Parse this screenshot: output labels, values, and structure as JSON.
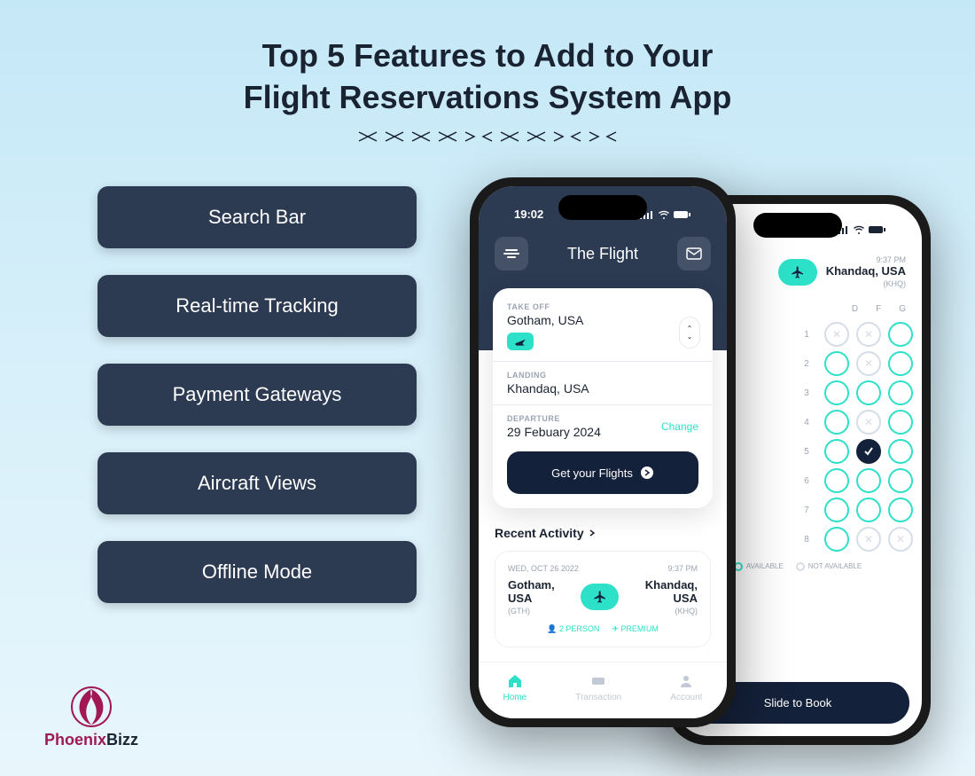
{
  "title_line1": "Top 5 Features to Add to Your",
  "title_line2": "Flight Reservations System App",
  "features": [
    "Search Bar",
    "Real-time Tracking",
    "Payment Gateways",
    "Aircraft Views",
    "Offline Mode"
  ],
  "logo": {
    "part1": "Phoenix",
    "part2": "Bizz"
  },
  "phone_front": {
    "time": "19:02",
    "app_title": "The Flight",
    "takeoff_label": "TAKE OFF",
    "takeoff_value": "Gotham, USA",
    "landing_label": "LANDING",
    "landing_value": "Khandaq, USA",
    "departure_label": "DEPARTURE",
    "departure_value": "29 Febuary 2024",
    "change": "Change",
    "cta": "Get your Flights",
    "recent_title": "Recent Activity",
    "activity": {
      "date": "WED, OCT 26 2022",
      "time": "9:37 PM",
      "from_city": "Gotham, USA",
      "from_code": "(GTH)",
      "to_city": "Khandaq, USA",
      "to_code": "(KHQ)",
      "persons": "2 PERSON",
      "class": "PREMIUM"
    },
    "nav": {
      "home": "Home",
      "transaction": "Transaction",
      "account": "Account"
    }
  },
  "phone_back": {
    "dest_time": "9:37 PM",
    "dest_city": "Khandaq, USA",
    "dest_code": "(KHQ)",
    "columns": [
      "D",
      "F",
      "G"
    ],
    "rows": [
      {
        "n": "1",
        "seats": [
          "taken",
          "taken",
          "avail"
        ]
      },
      {
        "n": "2",
        "seats": [
          "avail",
          "taken",
          "avail"
        ]
      },
      {
        "n": "3",
        "seats": [
          "avail",
          "avail",
          "avail"
        ]
      },
      {
        "n": "4",
        "seats": [
          "avail",
          "taken",
          "avail"
        ]
      },
      {
        "n": "5",
        "seats": [
          "avail",
          "selected",
          "avail"
        ]
      },
      {
        "n": "6",
        "seats": [
          "avail",
          "avail",
          "avail"
        ]
      },
      {
        "n": "7",
        "seats": [
          "avail",
          "avail",
          "avail"
        ]
      },
      {
        "n": "8",
        "seats": [
          "avail",
          "taken",
          "taken"
        ]
      }
    ],
    "legend_available": "AVAILABLE",
    "legend_not_available": "NOT AVAILABLE",
    "slide": "Slide to Book"
  }
}
